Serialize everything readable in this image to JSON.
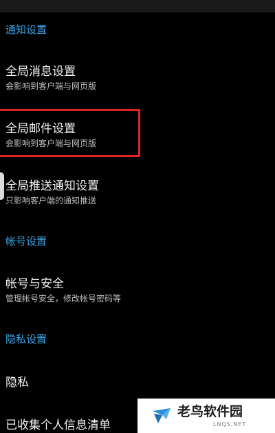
{
  "sections": {
    "notification": "通知设置",
    "account": "帐号设置",
    "privacy": "隐私设置"
  },
  "items": {
    "global_message": {
      "title": "全局消息设置",
      "subtitle": "会影响到客户端与网页版"
    },
    "global_mail": {
      "title": "全局邮件设置",
      "subtitle": "会影响到客户端与网页版"
    },
    "global_push": {
      "title": "全局推送通知设置",
      "subtitle": "只影响客户端的通知推送"
    },
    "account_security": {
      "title": "帐号与安全",
      "subtitle": "管理帐号安全，修改帐号密码等"
    },
    "privacy": {
      "title": "隐私"
    },
    "personal_info_list": {
      "title": "已收集个人信息清单"
    }
  },
  "watermark": {
    "brand": "老鸟软件园",
    "domain": "LNQS.NET"
  },
  "colors": {
    "background": "#000000",
    "section_header": "#39a6e8",
    "highlight_border": "#e02424"
  }
}
